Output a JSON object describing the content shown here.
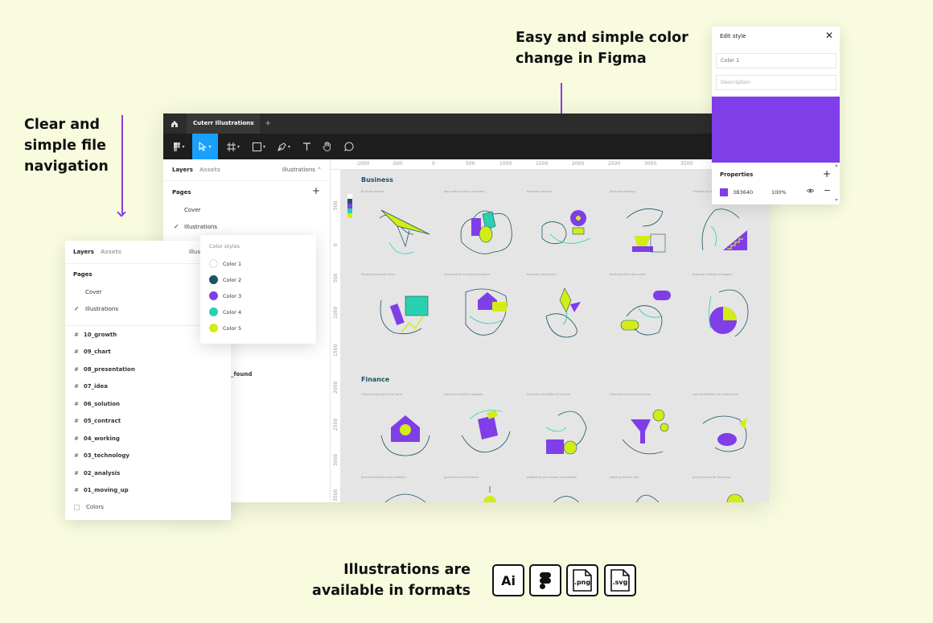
{
  "headings": {
    "left": "Clear and\nsimple file\nnavigation",
    "right": "Easy and simple color\nchange in Figma",
    "bottom": "Illustrations are\navailable in formats"
  },
  "figma": {
    "tab_title": "Cuterr Illustrations",
    "tab_close": "×",
    "new_tab": "+",
    "panel_tabs": {
      "layers": "Layers",
      "assets": "Assets",
      "page": "Illustrations ⌃"
    },
    "pages_heading": "Pages",
    "pages_add": "+",
    "pages": [
      {
        "label": "Cover"
      },
      {
        "label": "Illustrations"
      }
    ],
    "layer_partial": "_found",
    "ruler_top": [
      "-1000",
      "-500",
      "0",
      "500",
      "1000",
      "1500",
      "2000",
      "2500",
      "3000",
      "3500"
    ],
    "ruler_left": [
      "500",
      "0",
      "500",
      "1000",
      "1500",
      "2000",
      "2500",
      "3000",
      "3500"
    ],
    "canvas_sections": [
      {
        "title": "Business"
      },
      {
        "title": "Finance"
      }
    ],
    "captions_row1": [
      "Business startup",
      "Idea and success in business",
      "business idea key",
      "business planning",
      "climbing up ladder"
    ],
    "captions_row2": [
      "Personal business vision",
      "Investments in business projects",
      "business idea launch",
      "business client discussion",
      "business strategy managed"
    ],
    "captions_row3": [
      "Financial savings in the bank",
      "money to invest in property",
      "Financial calculation of income",
      "Financial services processing",
      "cost contribution to investments"
    ],
    "captions_row4": [
      "financial analytics and statistics",
      "government and finance",
      "protecting your money and savings",
      "keeping electric cars",
      "giving money for financing"
    ]
  },
  "edit_style": {
    "title": "Edit style",
    "close": "✕",
    "name_value": "Color 1",
    "description_placeholder": "Description",
    "properties_label": "Properties",
    "properties_add": "+",
    "hex": "3B3640",
    "opacity": "100%",
    "remove": "−"
  },
  "layers_overlay": {
    "tabs": {
      "layers": "Layers",
      "assets": "Assets",
      "page": "Illustra"
    },
    "pages_heading": "Pages",
    "pages": [
      {
        "label": "Cover"
      },
      {
        "label": "Illustrations"
      }
    ],
    "frames": [
      {
        "label": "10_growth"
      },
      {
        "label": "09_chart"
      },
      {
        "label": "08_presentation"
      },
      {
        "label": "07_idea"
      },
      {
        "label": "06_solution"
      },
      {
        "label": "05_contract"
      },
      {
        "label": "04_working"
      },
      {
        "label": "03_technology"
      },
      {
        "label": "02_analysis"
      },
      {
        "label": "01_moving_up"
      }
    ],
    "colors_label": "Colors"
  },
  "color_styles": {
    "heading": "Color styles",
    "items": [
      {
        "label": "Color 1",
        "color": "#ffffff"
      },
      {
        "label": "Color 2",
        "color": "#1d5566"
      },
      {
        "label": "Color 3",
        "color": "#7f3ee8"
      },
      {
        "label": "Color 4",
        "color": "#29d1b0"
      },
      {
        "label": "Color 5",
        "color": "#d4ec16"
      }
    ]
  },
  "formats": [
    {
      "label": "Ai",
      "icon": "ai-format-icon"
    },
    {
      "label": "",
      "icon": "figma-format-icon"
    },
    {
      "label": ".png",
      "icon": "png-format-icon"
    },
    {
      "label": ".svg",
      "icon": "svg-format-icon"
    }
  ],
  "colors": {
    "background": "#f8fbde",
    "accent_purple": "#7f3ee8",
    "lime": "#d4ec16",
    "teal": "#29d1b0",
    "dark_teal": "#1d5566",
    "figma_blue": "#18a0fb"
  }
}
